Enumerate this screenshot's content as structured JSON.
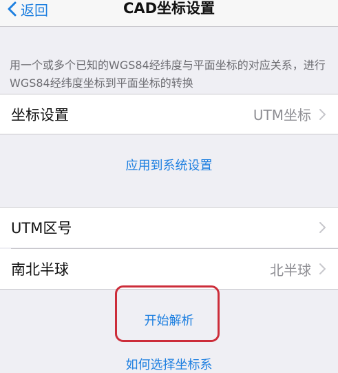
{
  "nav": {
    "back_label": "返回",
    "title": "CAD坐标设置"
  },
  "description": "用一个或多个已知的WGS84经纬度与平面坐标的对应关系，进行WGS84经纬度坐标到平面坐标的转换",
  "coordinate_setting": {
    "label": "坐标设置",
    "value": "UTM坐标"
  },
  "apply_button": "应用到系统设置",
  "utm_zone": {
    "label": "UTM区号",
    "value": ""
  },
  "hemisphere": {
    "label": "南北半球",
    "value": "北半球"
  },
  "start_button": "开始解析",
  "help_link": "如何选择坐标系",
  "colors": {
    "accent": "#1d7fe0",
    "highlight": "#cc2d3a",
    "background": "#efeff4"
  }
}
